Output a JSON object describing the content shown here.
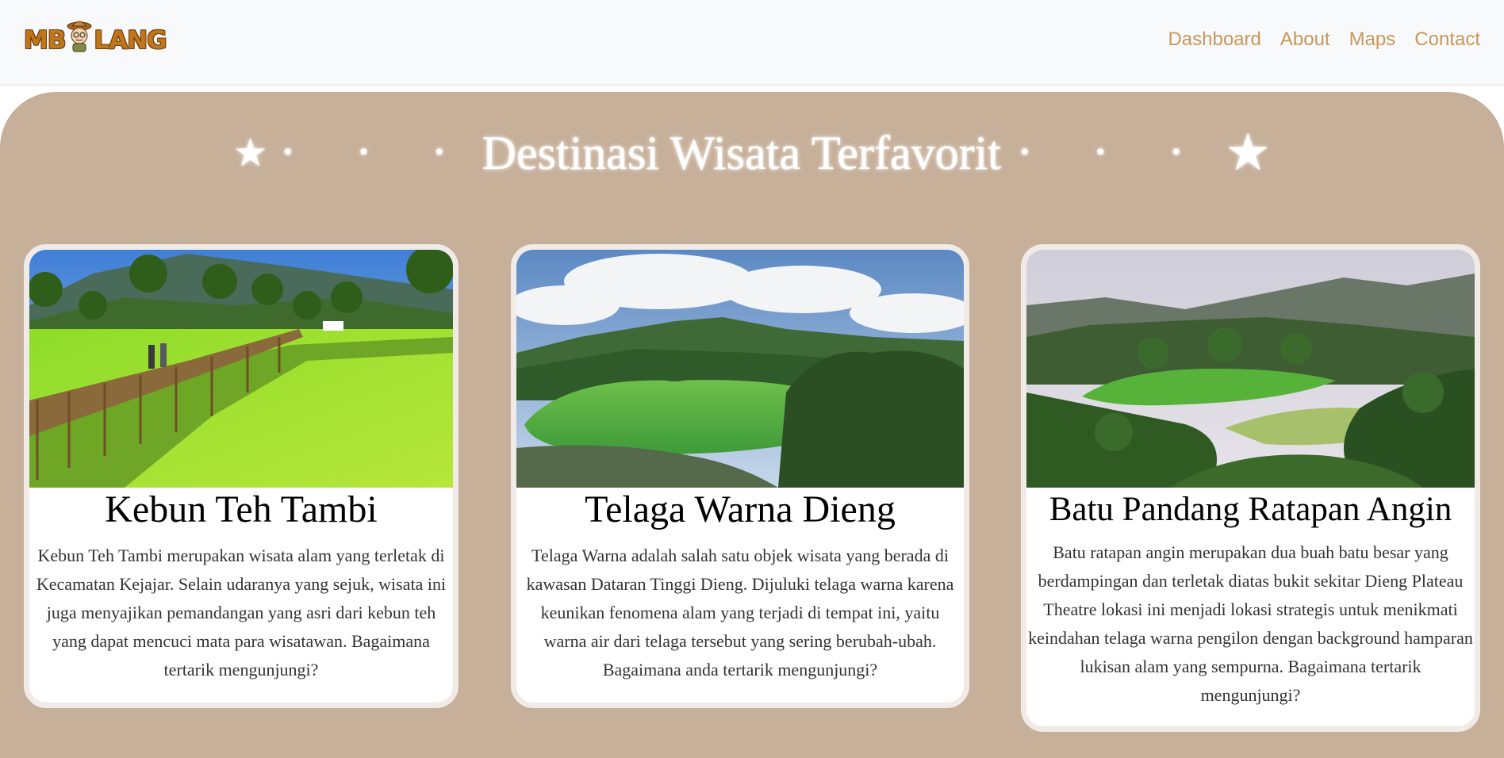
{
  "nav": {
    "logo_text": "MBOLANG",
    "links": [
      "Dashboard",
      "About",
      "Maps",
      "Contact"
    ]
  },
  "hero": {
    "title": "Destinasi Wisata Terfavorit",
    "star_left": "★",
    "star_right": "★",
    "dots": "• • •"
  },
  "cards": [
    {
      "title": "Kebun Teh Tambi",
      "text": "Kebun Teh Tambi merupakan wisata alam yang terletak di Kecamatan Kejajar. Selain udaranya yang sejuk, wisata ini juga menyajikan pemandangan yang asri dari kebun teh yang dapat mencuci mata para wisatawan. Bagaimana tertarik mengunjungi?"
    },
    {
      "title": "Telaga Warna Dieng",
      "text": "Telaga Warna adalah salah satu objek wisata yang berada di kawasan Dataran Tinggi Dieng. Dijuluki telaga warna karena keunikan fenomena alam yang terjadi di tempat ini, yaitu warna air dari telaga tersebut yang sering berubah-ubah. Bagaimana anda tertarik mengunjungi?"
    },
    {
      "title": "Batu Pandang Ratapan Angin",
      "text": "Batu ratapan angin merupakan dua buah batu besar yang berdampingan dan terletak diatas bukit sekitar Dieng Plateau Theatre lokasi ini menjadi lokasi strategis untuk menikmati keindahan telaga warna pengilon dengan background hamparan lukisan alam yang sempurna. Bagaimana tertarik mengunjungi?"
    }
  ],
  "colors": {
    "hero_bg": "#c7b09a",
    "nav_link": "#c8975c",
    "logo": "#c1761c"
  }
}
